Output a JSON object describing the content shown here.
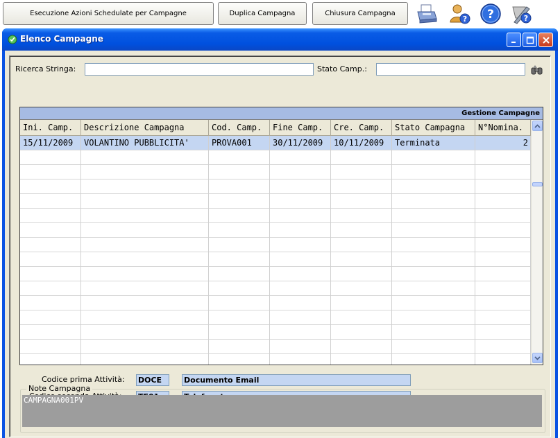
{
  "toolbar": {
    "buttons": [
      {
        "label": "Esecuzione Azioni Schedulate per Campagne"
      },
      {
        "label": "Duplica Campagna"
      },
      {
        "label": "Chiusura Campagna"
      }
    ],
    "icons": [
      "printer-icon",
      "user-help-icon",
      "help-icon",
      "edit-help-icon"
    ]
  },
  "window": {
    "title": "Elenco Campagne",
    "controls": [
      "minimize-icon",
      "maximize-icon",
      "close-icon"
    ]
  },
  "search": {
    "string_label": "Ricerca Stringa:",
    "string_value": "",
    "state_label": "Stato Camp.:",
    "state_value": ""
  },
  "grid": {
    "caption": "Gestione Campagne",
    "columns": [
      "Ini. Camp.",
      "Descrizione Campagna",
      "Cod. Camp.",
      "Fine Camp.",
      "Cre. Camp.",
      "Stato Campagna",
      "N°Nomina."
    ],
    "rows": [
      [
        "15/11/2009",
        "VOLANTINO PUBBLICITA'",
        "PROVA001",
        "30/11/2009",
        "10/11/2009",
        "Terminata",
        "2"
      ]
    ],
    "empty_rows": 15
  },
  "activities": {
    "first_label": "Codice prima Attività:",
    "first_code": "DOCE",
    "first_desc": "Documento Email",
    "second_label": "Codice seconda Attività:",
    "second_code": "TE01",
    "second_desc": "Telefonata"
  },
  "notes": {
    "label": "Note Campagna",
    "value": "CAMPAGNA001PV"
  },
  "colors": {
    "title_bar": "#0050de",
    "selected_row": "#c4d6f2",
    "caption_bar": "#a6bbe3",
    "window_bg": "#ece9d8"
  }
}
